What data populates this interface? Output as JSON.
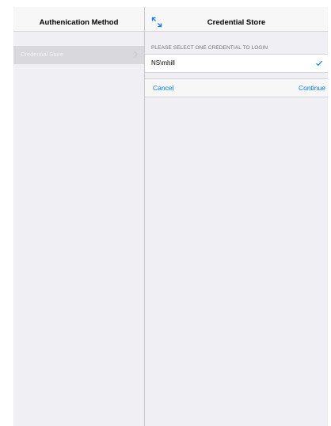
{
  "master": {
    "title": "Authenication Method",
    "items": [
      {
        "label": "Credential Store",
        "selected": true
      }
    ]
  },
  "detail": {
    "title": "Credential Store",
    "expand_icon": "expand-arrows-icon",
    "section_header": "PLEASE SELECT ONE CREDENTIAL TO LOGIN",
    "credentials": [
      {
        "label": "NS\\mhill",
        "checked": true
      }
    ],
    "actions": {
      "cancel_label": "Cancel",
      "continue_label": "Continue"
    }
  },
  "colors": {
    "accent": "#007aff",
    "background": "#efeff4",
    "nav_bar": "#f7f7f7",
    "selected_row": "#d9d9dd",
    "separator": "#d6d6da"
  }
}
